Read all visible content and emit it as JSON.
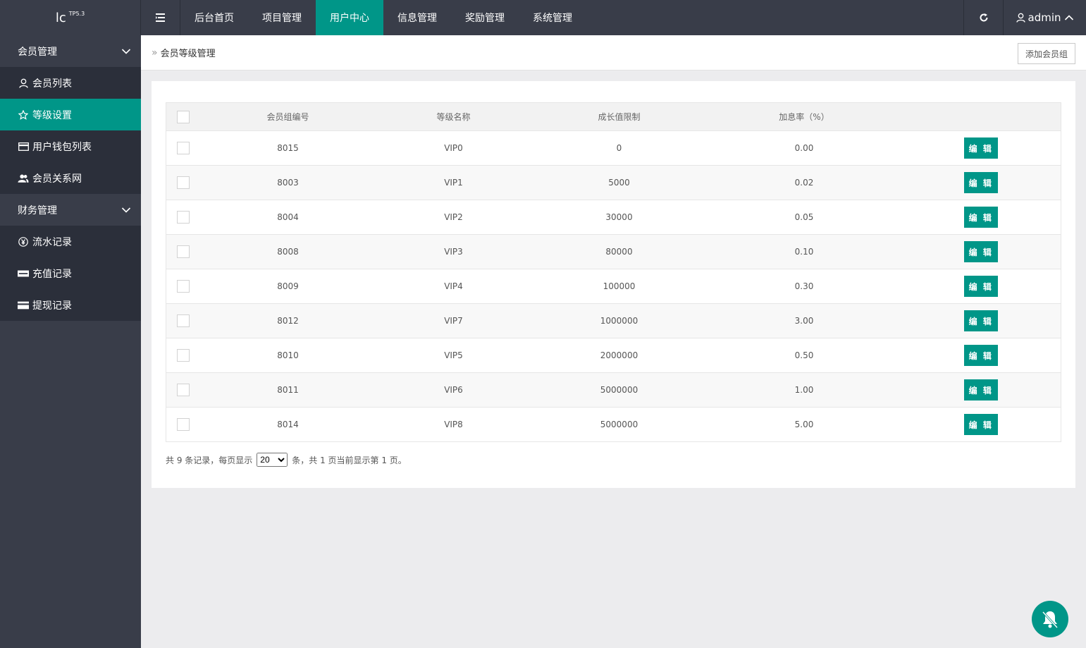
{
  "logo": {
    "text": "lc",
    "version": "TP5.3"
  },
  "nav": {
    "items": [
      "后台首页",
      "项目管理",
      "用户中心",
      "信息管理",
      "奖励管理",
      "系统管理"
    ],
    "active_index": 2
  },
  "user": {
    "name": "admin"
  },
  "sidebar": {
    "group1": "会员管理",
    "group1_items": [
      "会员列表",
      "等级设置",
      "用户钱包列表",
      "会员关系网"
    ],
    "group2": "财务管理",
    "group2_items": [
      "流水记录",
      "充值记录",
      "提现记录"
    ],
    "active_item": "等级设置"
  },
  "breadcrumb": {
    "title": "会员等级管理"
  },
  "toolbar": {
    "add_label": "添加会员组"
  },
  "table": {
    "headers": [
      "会员组编号",
      "等级名称",
      "成长值限制",
      "加息率（%）"
    ],
    "edit_label": "编 辑",
    "rows": [
      {
        "id": "8015",
        "name": "VIP0",
        "limit": "0",
        "rate": "0.00"
      },
      {
        "id": "8003",
        "name": "VIP1",
        "limit": "5000",
        "rate": "0.02"
      },
      {
        "id": "8004",
        "name": "VIP2",
        "limit": "30000",
        "rate": "0.05"
      },
      {
        "id": "8008",
        "name": "VIP3",
        "limit": "80000",
        "rate": "0.10"
      },
      {
        "id": "8009",
        "name": "VIP4",
        "limit": "100000",
        "rate": "0.30"
      },
      {
        "id": "8012",
        "name": "VIP7",
        "limit": "1000000",
        "rate": "3.00"
      },
      {
        "id": "8010",
        "name": "VIP5",
        "limit": "2000000",
        "rate": "0.50"
      },
      {
        "id": "8011",
        "name": "VIP6",
        "limit": "5000000",
        "rate": "1.00"
      },
      {
        "id": "8014",
        "name": "VIP8",
        "limit": "5000000",
        "rate": "5.00"
      }
    ]
  },
  "pager": {
    "prefix": "共 9 条记录，每页显示",
    "page_size": "20",
    "suffix": "条，共 1 页当前显示第 1 页。"
  },
  "colors": {
    "accent": "#009688",
    "dark": "#393d49"
  }
}
